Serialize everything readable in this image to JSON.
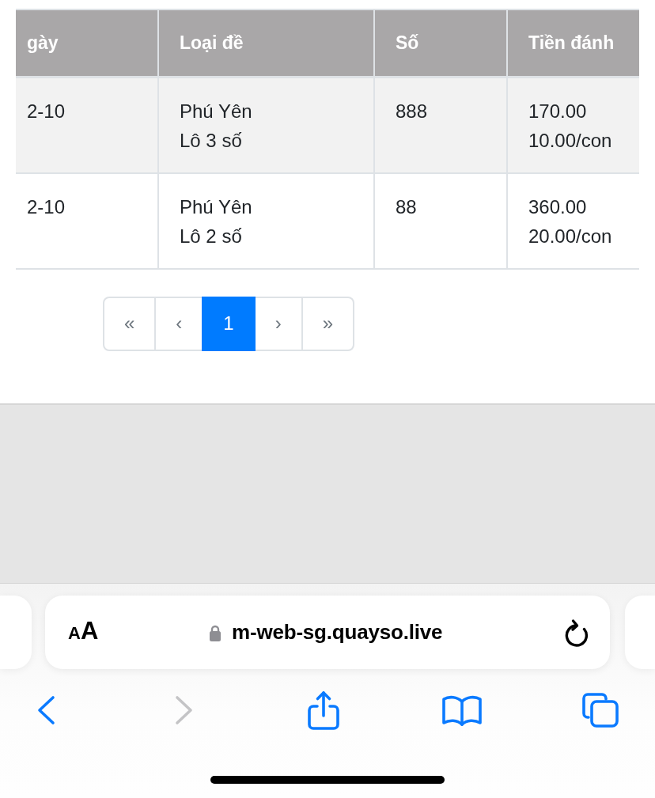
{
  "table": {
    "columns": [
      "gày",
      "Loại đề",
      "Số",
      "Tiền đánh"
    ],
    "rows": [
      {
        "cells": [
          [
            "2-10"
          ],
          [
            "Phú Yên",
            "Lô 3 số"
          ],
          [
            "888"
          ],
          [
            "170.00",
            "10.00/con"
          ]
        ]
      },
      {
        "cells": [
          [
            "2-10"
          ],
          [
            "Phú Yên",
            "Lô 2 số"
          ],
          [
            "88"
          ],
          [
            "360.00",
            "20.00/con"
          ]
        ]
      }
    ]
  },
  "pagination": [
    {
      "label": "«",
      "selected": false
    },
    {
      "label": "‹",
      "selected": false
    },
    {
      "label": "1",
      "selected": true
    },
    {
      "label": "›",
      "selected": false
    },
    {
      "label": "»",
      "selected": false
    }
  ],
  "browser": {
    "text_size_button": "AA",
    "url": "m-web-sg.quayso.live",
    "toolbar": [
      {
        "kind": "back",
        "disabled": false
      },
      {
        "kind": "forward",
        "disabled": true
      },
      {
        "kind": "share",
        "disabled": false
      },
      {
        "kind": "bookmarks",
        "disabled": false
      },
      {
        "kind": "tabs",
        "disabled": false
      }
    ]
  }
}
